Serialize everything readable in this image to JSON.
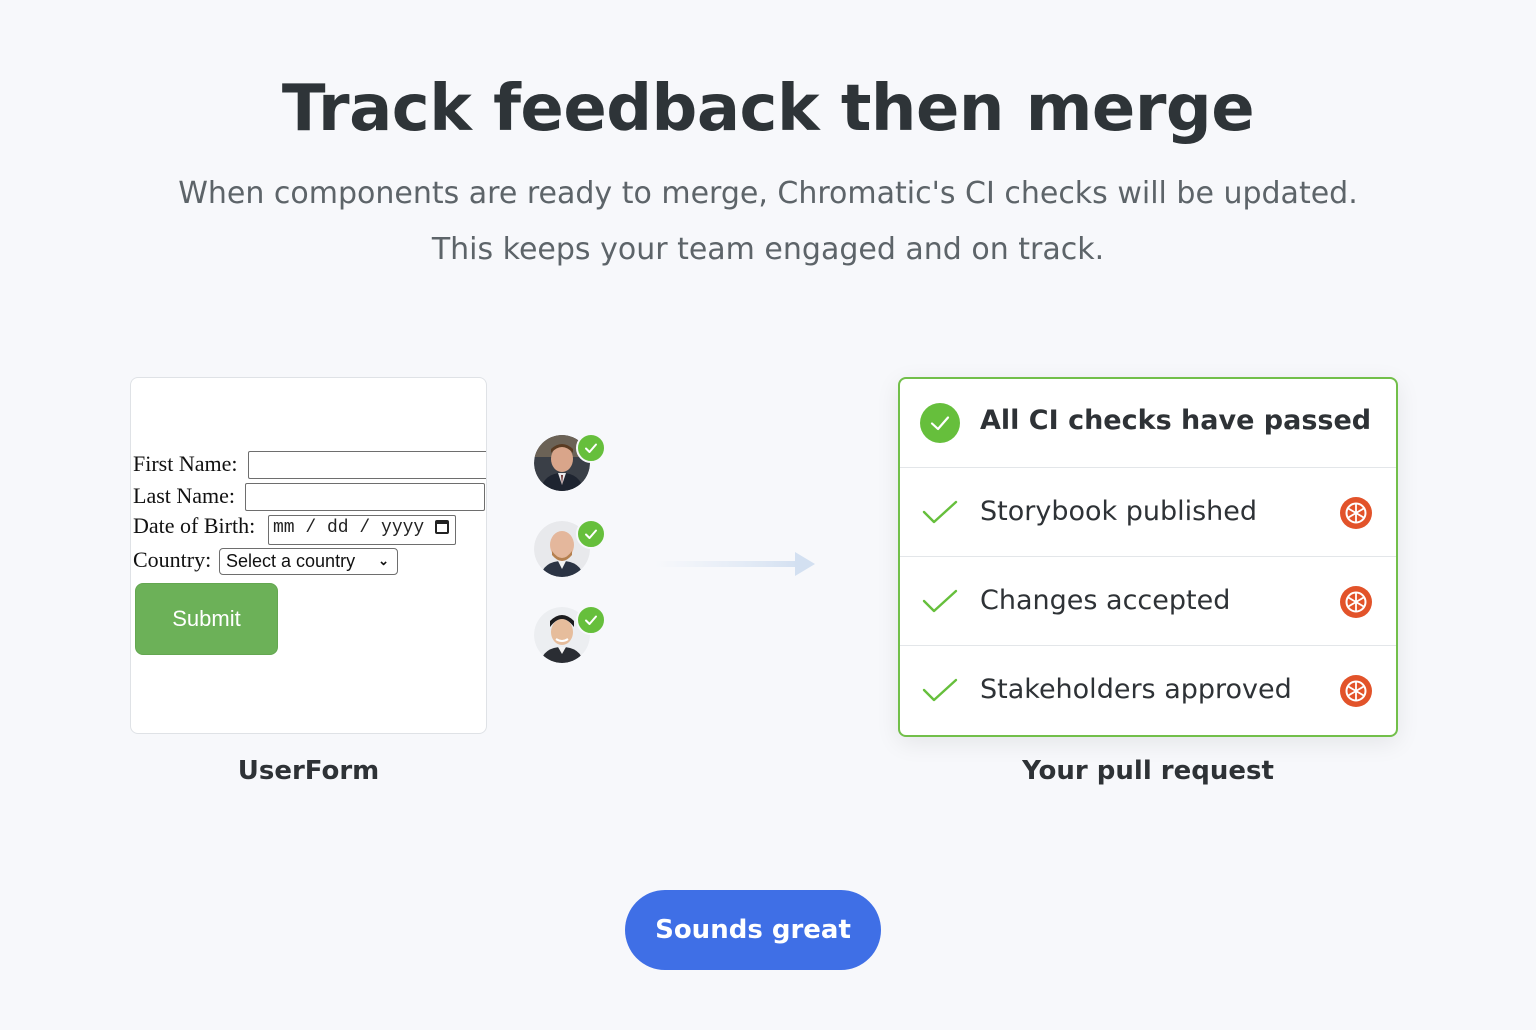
{
  "headline": "Track feedback then merge",
  "subtitle": "When components are ready to merge, Chromatic's CI checks will be updated. This keeps your team engaged and on track.",
  "story": {
    "caption": "UserForm",
    "form": {
      "first_name_label": "First Name:",
      "last_name_label": "Last Name:",
      "dob_label": "Date of Birth:",
      "dob_placeholder": "mm / dd / yyyy",
      "country_label": "Country:",
      "country_value": "Select a country",
      "submit_label": "Submit"
    }
  },
  "reviewers": [
    {
      "name": "reviewer-1",
      "approved": true
    },
    {
      "name": "reviewer-2",
      "approved": true
    },
    {
      "name": "reviewer-3",
      "approved": true
    }
  ],
  "pull_request": {
    "caption": "Your pull request",
    "status_title": "All CI checks have passed",
    "checks": [
      {
        "label": "Storybook published",
        "icon": "chromatic-icon"
      },
      {
        "label": "Changes accepted",
        "icon": "chromatic-icon"
      },
      {
        "label": "Stakeholders approved",
        "icon": "chromatic-icon"
      }
    ]
  },
  "cta_label": "Sounds great",
  "colors": {
    "accent_blue": "#3f6fe6",
    "success_green": "#66bf3c",
    "submit_green": "#6cb158",
    "chromatic_orange": "#e2532a"
  }
}
